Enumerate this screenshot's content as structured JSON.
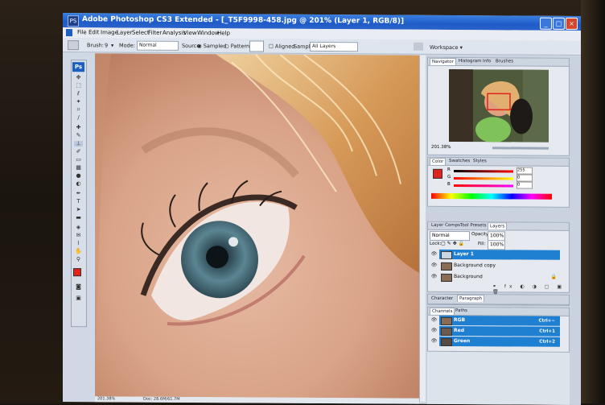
{
  "window": {
    "app_icon": "PS",
    "title": "Adobe Photoshop CS3 Extended - [_T5F9998-458.jpg @ 201% (Layer 1, RGB/8)]",
    "minimize": "_",
    "maximize": "□",
    "close": "×"
  },
  "menu": [
    "File",
    "Edit",
    "Image",
    "Layer",
    "Select",
    "Filter",
    "Analysis",
    "View",
    "Window",
    "Help"
  ],
  "options": {
    "brush_label": "Brush:",
    "brush_size": "9",
    "mode_label": "Mode:",
    "mode_value": "Normal",
    "source_label": "Source:",
    "sampled": "Sampled",
    "pattern": "Pattern:",
    "aligned": "Aligned",
    "sample_label": "Sample:",
    "sample_value": "All Layers",
    "workspace": "Workspace ▾"
  },
  "toolbox": {
    "logo": "Ps"
  },
  "status": {
    "zoom": "201.38%",
    "doc": "Doc: 28.6M/61.7M"
  },
  "navigator": {
    "tabs": [
      "Navigator",
      "Histogram",
      "Info",
      "Brushes"
    ],
    "zoom": "201.38%"
  },
  "color_panel": {
    "tabs": [
      "Color",
      "Swatches",
      "Styles"
    ],
    "r_label": "R",
    "r_value": "255",
    "g_label": "G",
    "g_value": "0",
    "b_label": "B",
    "b_value": "0"
  },
  "layers_panel": {
    "tabs": [
      "Layer Comps",
      "Tool Presets",
      "Layers"
    ],
    "blend_mode": "Normal",
    "opacity_label": "Opacity:",
    "opacity_value": "100%",
    "lock_label": "Lock:",
    "fill_label": "Fill:",
    "fill_value": "100%",
    "layers": [
      "Layer 1",
      "Background copy",
      "Background"
    ]
  },
  "character_panel": {
    "tabs": [
      "Character",
      "Paragraph"
    ]
  },
  "channels_panel": {
    "tabs": [
      "Channels",
      "Paths"
    ],
    "channels": [
      {
        "name": "RGB",
        "shortcut": "Ctrl+~"
      },
      {
        "name": "Red",
        "shortcut": "Ctrl+1"
      },
      {
        "name": "Green",
        "shortcut": "Ctrl+2"
      }
    ]
  },
  "colors": {
    "accent": "#1f7fd0",
    "titlebar": "#1f5bc8",
    "foreground": "#e0231b"
  }
}
